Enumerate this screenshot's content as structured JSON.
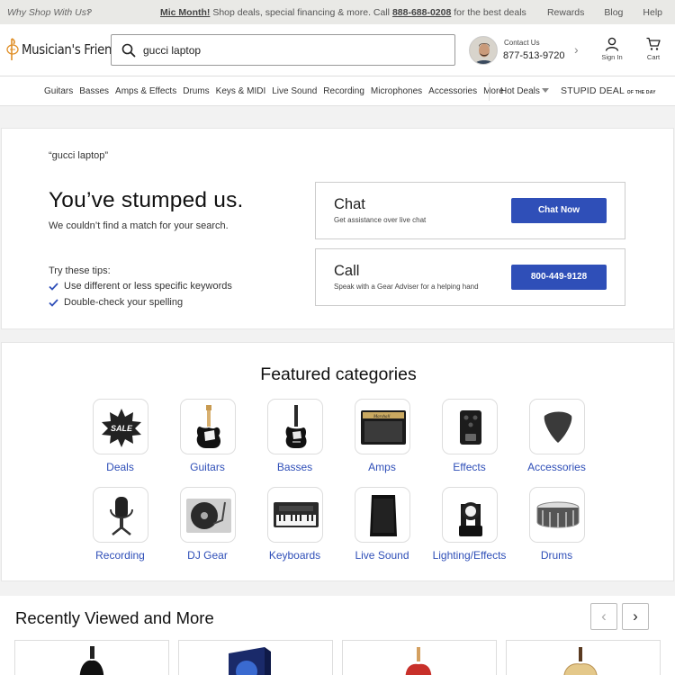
{
  "topbar": {
    "why": "Why Shop With Us?",
    "promo_bold": "Mic Month!",
    "promo_text": " Shop deals, special financing & more. Call ",
    "promo_phone": "888-688-0208",
    "promo_tail": " for the best deals",
    "links": [
      "Rewards",
      "Blog",
      "Help"
    ]
  },
  "header": {
    "logo_text": "Musician's Friend",
    "search_value": "gucci laptop",
    "contact_label": "Contact Us",
    "contact_phone": "877-513-9720",
    "signin_label": "Sign In",
    "cart_label": "Cart"
  },
  "nav": {
    "items": [
      "Guitars",
      "Basses",
      "Amps & Effects",
      "Drums",
      "Keys & MIDI",
      "Live Sound",
      "Recording",
      "Microphones",
      "Accessories",
      "More"
    ],
    "hot_deals": "Hot Deals",
    "stupid_deal": "STUPID DEAL",
    "stupid_small": "OF THE DAY"
  },
  "results": {
    "query": "“gucci laptop”",
    "heading": "You’ve stumped us.",
    "subheading": "We couldn’t find a match for your search.",
    "tips_label": "Try these tips:",
    "tips": [
      "Use different or less specific keywords",
      "Double-check your spelling"
    ],
    "chat": {
      "title": "Chat",
      "subtitle": "Get assistance over live chat",
      "button": "Chat Now"
    },
    "call": {
      "title": "Call",
      "subtitle": "Speak with a Gear Adviser for a helping hand",
      "button": "800-449-9128"
    }
  },
  "featured": {
    "title": "Featured categories",
    "categories": [
      "Deals",
      "Guitars",
      "Basses",
      "Amps",
      "Effects",
      "Accessories",
      "Recording",
      "DJ Gear",
      "Keyboards",
      "Live Sound",
      "Lighting/Effects",
      "Drums"
    ],
    "deals_badge": "SALE"
  },
  "recent": {
    "title": "Recently Viewed and More",
    "prev_icon": "chevron-left-icon",
    "next_icon": "chevron-right-icon"
  },
  "colors": {
    "accent": "#2f4fb8",
    "logo_orange": "#e0902a"
  }
}
